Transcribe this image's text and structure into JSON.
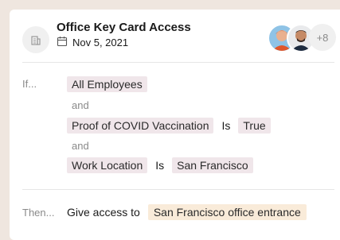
{
  "header": {
    "title": "Office Key Card Access",
    "date": "Nov 5, 2021",
    "more_count": "+8"
  },
  "conditions": {
    "if_label": "If...",
    "first": "All Employees",
    "and_1": "and",
    "second_key": "Proof of COVID Vaccination",
    "second_op": "Is",
    "second_value": "True",
    "and_2": "and",
    "third_key": "Work Location",
    "third_op": "Is",
    "third_value": "San Francisco"
  },
  "action": {
    "then_label": "Then...",
    "text": "Give access to",
    "target": "San Francisco office entrance"
  },
  "icons": {
    "header": "building-icon",
    "date": "calendar-icon"
  }
}
